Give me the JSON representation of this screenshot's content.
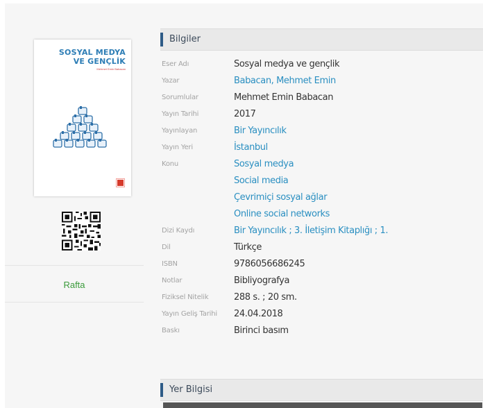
{
  "cover": {
    "title_line1": "SOSYAL MEDYA",
    "title_line2": "VE GENÇLİK",
    "author": "Mehmet Emin Babacan",
    "accent_color": "#2d7db5"
  },
  "shelf": {
    "label": "Rafta",
    "color": "#3a9a3a"
  },
  "info_section": {
    "title": "Bilgiler"
  },
  "location_section": {
    "title": "Yer Bilgisi"
  },
  "fields": {
    "eser_adi": {
      "label": "Eser Adı",
      "value": "Sosyal medya ve gençlik"
    },
    "yazar": {
      "label": "Yazar",
      "value": "Babacan, Mehmet Emin"
    },
    "sorumlular": {
      "label": "Sorumlular",
      "value": "Mehmet Emin Babacan"
    },
    "yayin_tarihi": {
      "label": "Yayın Tarihi",
      "value": "2017"
    },
    "yayinlayan": {
      "label": "Yayınlayan",
      "value": "Bir Yayıncılık"
    },
    "yayin_yeri": {
      "label": "Yayın Yeri",
      "value": "İstanbul"
    },
    "konu": {
      "label": "Konu",
      "values": [
        "Sosyal medya",
        "Social media",
        "Çevrimiçi sosyal ağlar",
        "Online social networks"
      ]
    },
    "dizi_kaydi": {
      "label": "Dizi Kaydı",
      "value": "Bir Yayıncılık ; 3. İletişim Kitaplığı ; 1."
    },
    "dil": {
      "label": "Dil",
      "value": "Türkçe"
    },
    "isbn": {
      "label": "ISBN",
      "value": "9786056686245"
    },
    "notlar": {
      "label": "Notlar",
      "value": "Bibliyografya"
    },
    "fiziksel_nitelik": {
      "label": "Fiziksel Nitelik",
      "value": "288 s. ; 20 sm."
    },
    "yayin_gelis_tarihi": {
      "label": "Yayın Geliş Tarihi",
      "value": "24.04.2018"
    },
    "baski": {
      "label": "Baskı",
      "value": "Birinci basım"
    }
  },
  "colors": {
    "link": "#2a8fc1",
    "label": "#a3a3a3",
    "section_bar": "#2e5b87"
  }
}
